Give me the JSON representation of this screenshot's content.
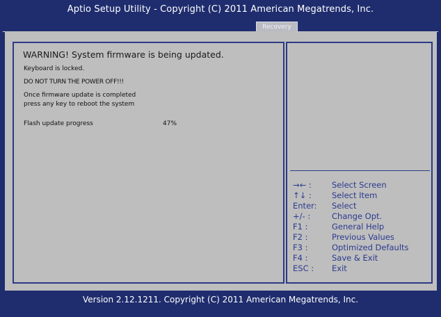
{
  "header": {
    "title": "Aptio Setup Utility - Copyright (C) 2011 American Megatrends, Inc.",
    "tab": "Recovery"
  },
  "main": {
    "warning": "WARNING! System firmware is being updated.",
    "keyboard_locked": "Keyboard is locked.",
    "do_not_power_off": "DO NOT TURN THE POWER OFF!!!",
    "reboot_line1": "Once firmware update is completed",
    "reboot_line2": "press any key to reboot the system",
    "progress_label": "Flash update progress",
    "progress_value": "47%"
  },
  "help": [
    {
      "key": "→← :",
      "desc": "Select Screen"
    },
    {
      "key": "↑↓  :",
      "desc": "Select Item"
    },
    {
      "key": "Enter:",
      "desc": "Select"
    },
    {
      "key": "+/-  :",
      "desc": "Change Opt."
    },
    {
      "key": "F1 :",
      "desc": "General Help"
    },
    {
      "key": "F2 :",
      "desc": "Previous Values"
    },
    {
      "key": "F3 :",
      "desc": "Optimized Defaults"
    },
    {
      "key": "F4 :",
      "desc": "Save & Exit"
    },
    {
      "key": "ESC :",
      "desc": "Exit"
    }
  ],
  "footer": {
    "version": "Version 2.12.1211. Copyright (C) 2011 American Megatrends, Inc."
  },
  "colors": {
    "background": "#1f2d6e",
    "panel": "#bebebe",
    "help_text": "#2b3a8f"
  }
}
